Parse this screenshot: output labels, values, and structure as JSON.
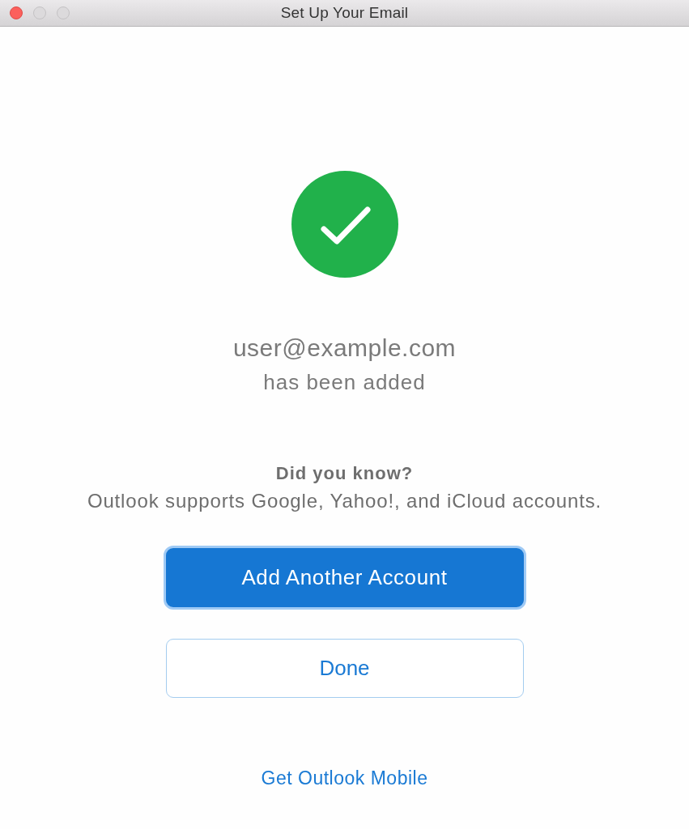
{
  "window": {
    "title": "Set Up Your Email",
    "buttons": [
      {
        "kind": "close",
        "disabled": false
      },
      {
        "kind": "minimize",
        "disabled": true
      },
      {
        "kind": "zoom",
        "disabled": true
      }
    ]
  },
  "result": {
    "account": "user@example.com",
    "message": "has been added"
  },
  "tip": {
    "heading": "Did you know?",
    "text": "Outlook supports Google, Yahoo!, and iCloud accounts."
  },
  "buttons": [
    {
      "label": "Add Another Account",
      "kind": "primary",
      "focused": true
    },
    {
      "label": "Done",
      "kind": "secondary",
      "focused": false
    }
  ],
  "link": {
    "label": "Get Outlook Mobile"
  }
}
